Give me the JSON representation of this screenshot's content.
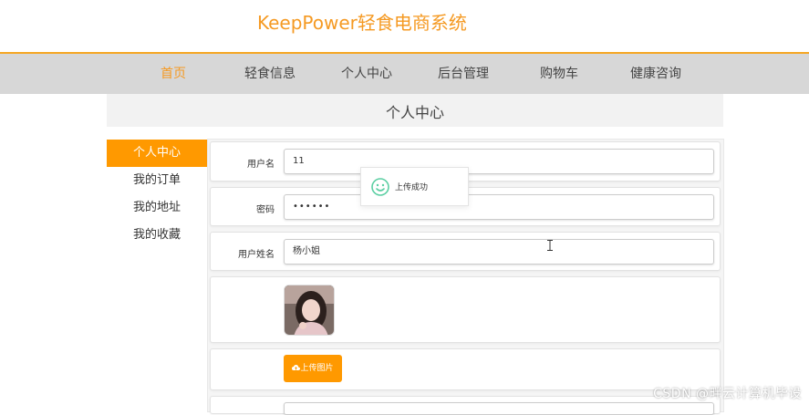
{
  "header": {
    "brand": "KeepPower轻食电商系统"
  },
  "nav": {
    "items": [
      {
        "label": "首页",
        "active": true
      },
      {
        "label": "轻食信息",
        "active": false
      },
      {
        "label": "个人中心",
        "active": false
      },
      {
        "label": "后台管理",
        "active": false
      },
      {
        "label": "购物车",
        "active": false
      },
      {
        "label": "健康咨询",
        "active": false
      }
    ]
  },
  "page": {
    "title": "个人中心"
  },
  "sidebar": {
    "items": [
      {
        "label": "个人中心",
        "active": true
      },
      {
        "label": "我的订单",
        "active": false
      },
      {
        "label": "我的地址",
        "active": false
      },
      {
        "label": "我的收藏",
        "active": false
      }
    ]
  },
  "form": {
    "username_label": "用户名",
    "username_value": "11",
    "password_label": "密码",
    "password_value": "••••••",
    "realname_label": "用户姓名",
    "realname_value": "杨小姐",
    "upload_label": "上传图片"
  },
  "toast": {
    "message": "上传成功"
  },
  "watermark": {
    "text": "CSDN @畔云计算机毕设"
  },
  "colors": {
    "accent": "#ff9900",
    "brand": "#f59a23",
    "nav_bg": "#d7d7d7",
    "toast_icon": "#5ccfa3"
  }
}
